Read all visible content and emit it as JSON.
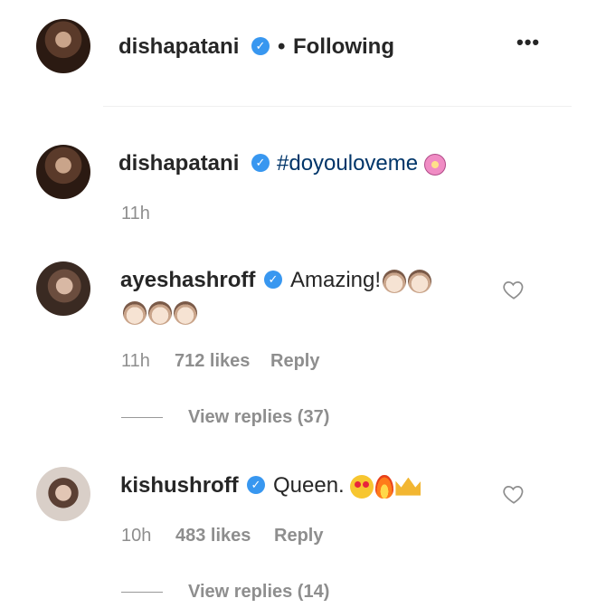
{
  "header": {
    "username": "dishapatani",
    "separator": "•",
    "follow_status": "Following",
    "more_icon": "more-options-icon",
    "more_label": "•••"
  },
  "caption": {
    "username": "dishapatani",
    "text": "#doyouloveme",
    "time": "11h"
  },
  "comments": [
    {
      "username": "ayeshashroff",
      "text": "Amazing!",
      "time": "11h",
      "likes": "712 likes",
      "reply": "Reply",
      "view_replies": "View replies (37)"
    },
    {
      "username": "kishushroff",
      "text": "Queen.",
      "time": "10h",
      "likes": "483 likes",
      "reply": "Reply",
      "view_replies": "View replies (14)"
    }
  ],
  "colors": {
    "verified": "#3897f0",
    "hashtag": "#003569",
    "meta": "#8e8e8e"
  }
}
